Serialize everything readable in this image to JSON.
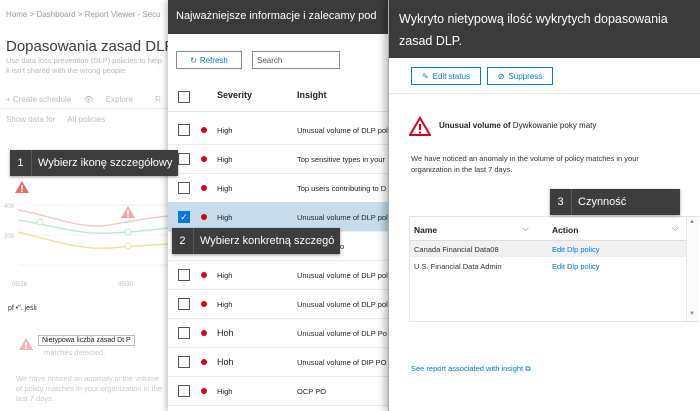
{
  "colors": {
    "accent": "#0078d4",
    "header_bg": "#3b3b3b",
    "severity_high": "#d0021b",
    "warning": "#d0021b",
    "selected_row": "#c7dceb"
  },
  "back": {
    "breadcrumb": "Home  >  Dashboard  >  Report Viewer - Secu",
    "title": "Dopasowania zasad DLP",
    "description": "Use data loss prevention (DLP) policies to help k isn't shared with the wrong people.",
    "toolbar": {
      "create_schedule": "+ Create schedule",
      "explore": "Explore",
      "more": "R"
    },
    "show_data_for": "Show data for",
    "all_policies": "All policies",
    "chart": {
      "y_labels": [
        "400",
        "200"
      ],
      "x_labels": [
        "05/26",
        "05/30"
      ]
    },
    "caption": "pf •\". jeśli",
    "alert_box_label": "Nietypowa liczba zasad Dt P",
    "alert_matches": "matches detected.",
    "alert_text": "We have noticed an anomaly in the volume of policy matches in your organization in the last 7 days."
  },
  "middle": {
    "title": "Najważniejsze informacje i zalecamy pod",
    "refresh_label": "Refresh",
    "search_placeholder": "Search",
    "columns": {
      "severity": "Severity",
      "insight": "Insight"
    },
    "rows": [
      {
        "severity": "High",
        "insight": "Unusual volume of DLP poli",
        "checked": false
      },
      {
        "severity": "High",
        "insight": "Top sensitive types in your",
        "checked": false
      },
      {
        "severity": "High",
        "insight": "Top users contributing to D",
        "checked": false
      },
      {
        "severity": "High",
        "insight": "Unusual volume of DLP poli",
        "checked": true
      },
      {
        "severity": "High",
        "insight": "contributing to",
        "checked": false
      },
      {
        "severity": "High",
        "insight": "Unusual volume of DLP poli",
        "checked": false
      },
      {
        "severity": "High",
        "insight": "Unusual volume of DLP poli",
        "checked": false
      },
      {
        "severity": "Hoh",
        "insight": "Unusual volume of DLP Po",
        "checked": false
      },
      {
        "severity": "Hoh",
        "insight": "Unusual volume of DIP PO",
        "checked": false
      },
      {
        "severity": "High",
        "insight": "OCP PO",
        "checked": false
      }
    ]
  },
  "front": {
    "title": "Wykryto nietypową ilość wykrytych dopasowania zasad DLP.",
    "edit_status": "Edit status",
    "suppress": "Suppress",
    "unusual_bold": "Unusual volume of",
    "unusual_rest": "Dywkowanie poky maty",
    "anomaly_text": "We have noticed an anomaly in the volume of policy matches in your organization in the last 7 days.",
    "table": {
      "col_name": "Name",
      "col_action": "Action",
      "rows": [
        {
          "name": "Canada Financial Data08",
          "action": "Edit Dlp policy"
        },
        {
          "name": "U.S. Financial Data Admin",
          "action": "Edit Dlp policy"
        }
      ]
    },
    "see_report": "See report associated with insight"
  },
  "callouts": [
    {
      "num": "1",
      "text": "Wybierz ikonę szczegółowy"
    },
    {
      "num": "2",
      "text": "Wybierz konkretną szczegó"
    },
    {
      "num": "3",
      "text": "Czynność"
    }
  ]
}
